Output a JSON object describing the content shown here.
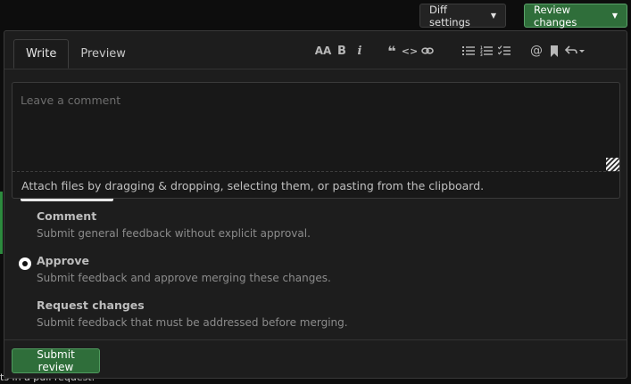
{
  "header": {
    "diff_settings_label": "Diff settings",
    "review_changes_label": "Review changes"
  },
  "background": {
    "text": "ts in a pull request."
  },
  "tabs": [
    {
      "label": "Write",
      "active": true
    },
    {
      "label": "Preview",
      "active": false
    }
  ],
  "toolbar": {
    "heading": "AA",
    "bold": "B",
    "italic": "i",
    "quote": "❝",
    "code": "<>",
    "link": "🔗",
    "mention": "@"
  },
  "comment": {
    "placeholder": "Leave a comment",
    "value": "",
    "attach_text": "Attach files by dragging & dropping, selecting them, or pasting from the clipboard."
  },
  "options": [
    {
      "title": "Comment",
      "description": "Submit general feedback without explicit approval.",
      "checked": false
    },
    {
      "title": "Approve",
      "description": "Submit feedback and approve merging these changes.",
      "checked": true
    },
    {
      "title": "Request changes",
      "description": "Submit feedback that must be addressed before merging.",
      "checked": false
    }
  ],
  "submit_label": "Submit review",
  "colors": {
    "accent_green": "#2f6e3a",
    "panel_bg": "#1d1d1d"
  }
}
